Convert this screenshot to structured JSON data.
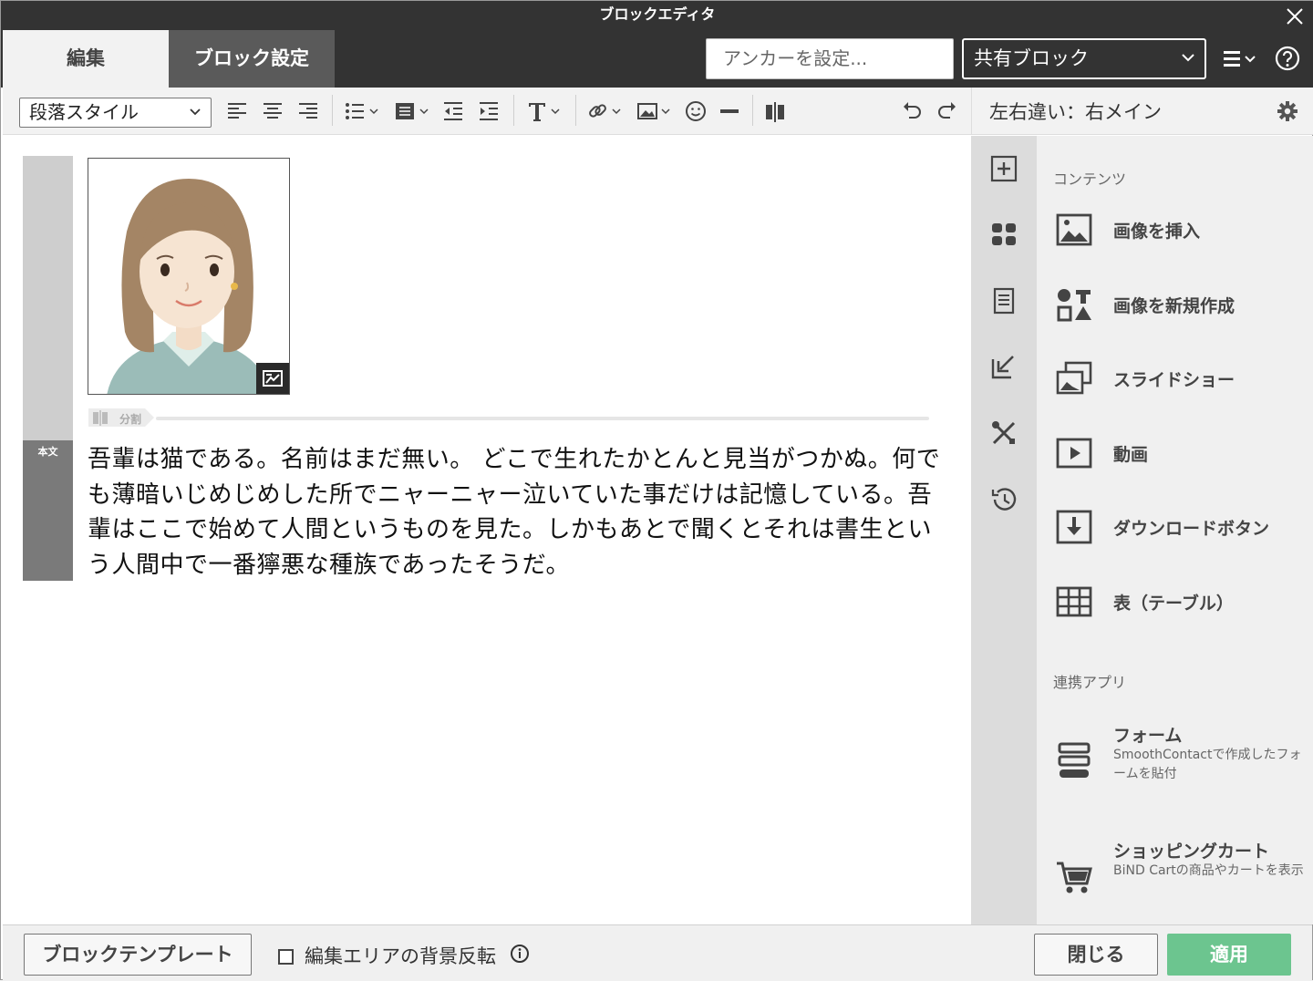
{
  "window": {
    "title": "ブロックエディタ"
  },
  "tabs": {
    "edit": "編集",
    "block_settings": "ブロック設定"
  },
  "header": {
    "anchor_placeholder": "アンカーを設定...",
    "shared_block": "共有ブロック"
  },
  "toolbar": {
    "paragraph_style": "段落スタイル"
  },
  "right_header": {
    "title": "左右違い：右メイン"
  },
  "editor": {
    "body_label": "本文",
    "split_label": "分割",
    "paragraph": "吾輩は猫である。名前はまだ無い。 どこで生れたかとんと見当がつかぬ。何でも薄暗いじめじめした所でニャーニャー泣いていた事だけは記憶している。吾輩はここで始めて人間というものを見た。しかもあとで聞くとそれは書生という人間中で一番獰悪な種族であったそうだ。"
  },
  "panel": {
    "contents_heading": "コンテンツ",
    "items": [
      {
        "label": "画像を挿入",
        "icon": "image-icon"
      },
      {
        "label": "画像を新規作成",
        "icon": "shapes-icon"
      },
      {
        "label": "スライドショー",
        "icon": "slideshow-icon"
      },
      {
        "label": "動画",
        "icon": "video-icon"
      },
      {
        "label": "ダウンロードボタン",
        "icon": "download-icon"
      },
      {
        "label": "表（テーブル）",
        "icon": "table-icon"
      }
    ],
    "apps_heading": "連携アプリ",
    "apps": [
      {
        "label": "フォーム",
        "desc": "SmoothContactで作成したフォームを貼付",
        "icon": "form-icon"
      },
      {
        "label": "ショッピングカート",
        "desc": "BiND Cartの商品やカートを表示",
        "icon": "cart-icon"
      }
    ]
  },
  "footer": {
    "template_button": "ブロックテンプレート",
    "invert_label": "編集エリアの背景反転",
    "close_button": "閉じる",
    "apply_button": "適用"
  },
  "colors": {
    "header_bg": "#333333",
    "apply": "#6cc58f",
    "panel_bg": "#f0f0f0"
  }
}
